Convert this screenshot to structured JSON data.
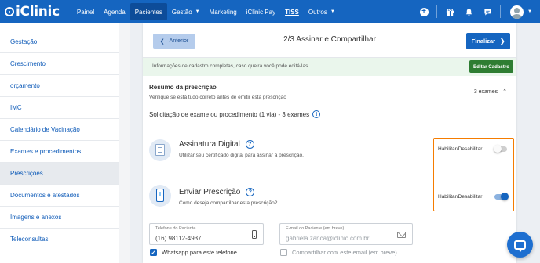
{
  "brand": {
    "name": "iClinic"
  },
  "nav": {
    "items": [
      {
        "label": "Painel"
      },
      {
        "label": "Agenda"
      },
      {
        "label": "Pacientes"
      },
      {
        "label": "Gestão"
      },
      {
        "label": "Marketing"
      },
      {
        "label": "iClinic Pay"
      },
      {
        "label": "TISS"
      },
      {
        "label": "Outros"
      }
    ],
    "active": "Pacientes"
  },
  "sidebar": {
    "items": [
      {
        "label": "Gestação"
      },
      {
        "label": "Crescimento"
      },
      {
        "label": "orçamento"
      },
      {
        "label": "IMC"
      },
      {
        "label": "Calendário de Vacinação"
      },
      {
        "label": "Exames e procedimentos"
      },
      {
        "label": "Prescrições"
      },
      {
        "label": "Documentos e atestados"
      },
      {
        "label": "Imagens e anexos"
      },
      {
        "label": "Teleconsultas"
      }
    ],
    "active": "Prescrições"
  },
  "stepper": {
    "prev_label": "Anterior",
    "title": "2/3 Assinar e Compartilhar",
    "finish_label": "Finalizar"
  },
  "notice": {
    "text": "Informações de cadastro completas, caso queira você pode editá-las",
    "edit_label": "Editar Cadastro"
  },
  "summary": {
    "title": "Resumo da prescrição",
    "subtitle": "Verifique se está tudo correto antes de emitir esta prescrição",
    "exam_count": "3 exames",
    "request": "Solicitação de exame ou procedimento (1 via) - 3 exames"
  },
  "signature": {
    "title": "Assinatura Digital",
    "subtitle": "Utilizar seu certificado digital para assinar a prescrição.",
    "toggle_label": "Habilitar/Desabilitar",
    "enabled": false
  },
  "send": {
    "title": "Enviar Prescrição",
    "subtitle": "Como deseja compartilhar esta prescrição?",
    "toggle_label": "Habilitar/Desabilitar",
    "enabled": true,
    "phone": {
      "label": "Telefone do Paciente",
      "value": "(16) 98112-4937"
    },
    "email": {
      "label": "E-mail do Paciente (em breve)",
      "value": "gabriela.zanca@iclinic.com.br"
    },
    "whatsapp": {
      "label": "Whatsapp para este telefone",
      "checked": true
    },
    "share_email": {
      "label": "Compartilhar com este email (em breve)",
      "checked": false
    }
  },
  "colors": {
    "primary": "#1565c0",
    "success": "#2e7d32",
    "highlight": "#f57c00",
    "notice_bg": "#eaf6ec"
  }
}
